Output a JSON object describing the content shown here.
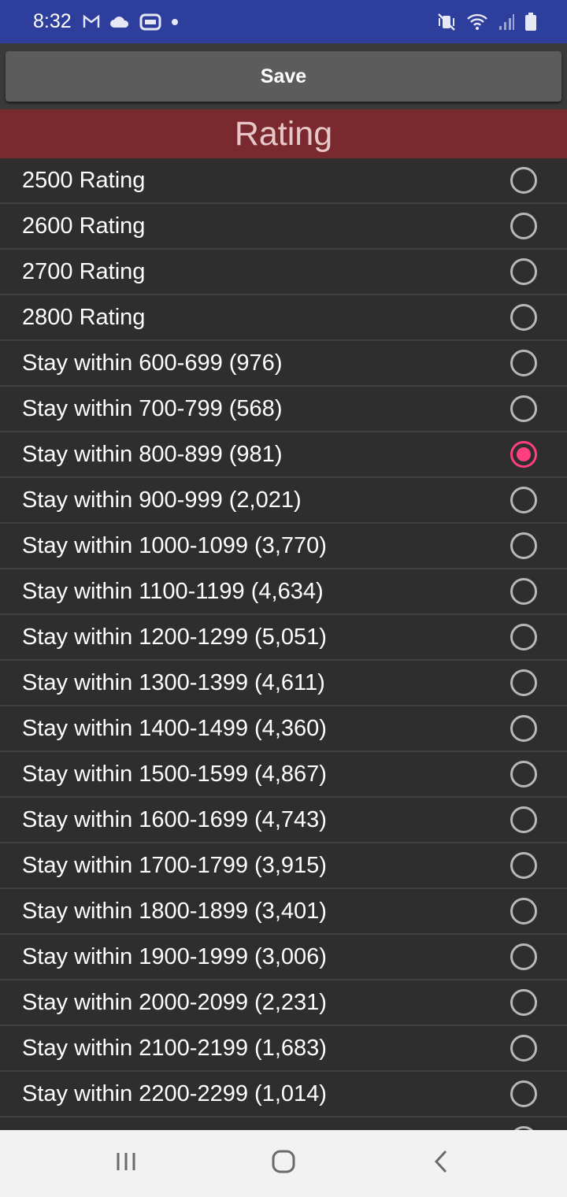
{
  "status_bar": {
    "time": "8:32",
    "left_icons": [
      "gmail-icon",
      "cloud-icon",
      "media-icon",
      "dot-icon"
    ],
    "right_icons": [
      "vibrate-mute-icon",
      "wifi-icon",
      "signal-icon",
      "battery-icon"
    ],
    "background": "#2d3e9c"
  },
  "toolbar": {
    "save_label": "Save"
  },
  "section": {
    "title": "Rating",
    "background": "#7a2a2e"
  },
  "options": [
    {
      "label": "2500 Rating",
      "selected": false
    },
    {
      "label": "2600 Rating",
      "selected": false
    },
    {
      "label": "2700 Rating",
      "selected": false
    },
    {
      "label": "2800 Rating",
      "selected": false
    },
    {
      "label": "Stay within 600-699 (976)",
      "selected": false
    },
    {
      "label": "Stay within 700-799 (568)",
      "selected": false
    },
    {
      "label": "Stay within 800-899 (981)",
      "selected": true
    },
    {
      "label": "Stay within 900-999 (2,021)",
      "selected": false
    },
    {
      "label": "Stay within 1000-1099 (3,770)",
      "selected": false
    },
    {
      "label": "Stay within 1100-1199 (4,634)",
      "selected": false
    },
    {
      "label": "Stay within 1200-1299 (5,051)",
      "selected": false
    },
    {
      "label": "Stay within 1300-1399 (4,611)",
      "selected": false
    },
    {
      "label": "Stay within 1400-1499 (4,360)",
      "selected": false
    },
    {
      "label": "Stay within 1500-1599 (4,867)",
      "selected": false
    },
    {
      "label": "Stay within 1600-1699 (4,743)",
      "selected": false
    },
    {
      "label": "Stay within 1700-1799 (3,915)",
      "selected": false
    },
    {
      "label": "Stay within 1800-1899 (3,401)",
      "selected": false
    },
    {
      "label": "Stay within 1900-1999 (3,006)",
      "selected": false
    },
    {
      "label": "Stay within 2000-2099 (2,231)",
      "selected": false
    },
    {
      "label": "Stay within 2100-2199 (1,683)",
      "selected": false
    },
    {
      "label": "Stay within 2200-2299 (1,014)",
      "selected": false
    },
    {
      "label": "",
      "selected": false
    }
  ],
  "accent_color": "#ff3f7f",
  "nav_bar": {
    "buttons": [
      "recents-icon",
      "home-icon",
      "back-icon"
    ]
  }
}
